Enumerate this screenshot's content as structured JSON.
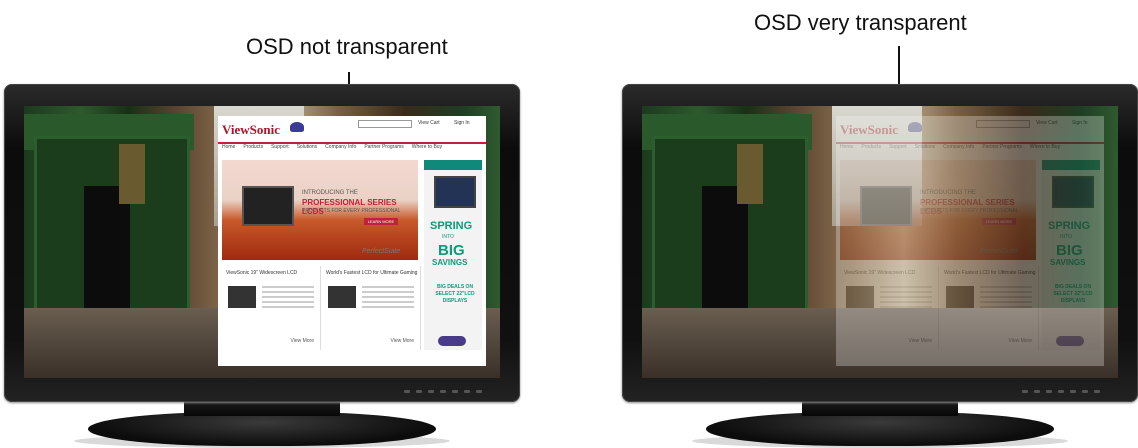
{
  "captions": {
    "left": "OSD not transparent",
    "right": "OSD very transparent"
  },
  "osd": {
    "logo": "ViewSonic",
    "cart": "View Cart",
    "signin": "Sign In",
    "nav": [
      "Home",
      "Products",
      "Support",
      "Solutions",
      "Company Info",
      "Partner Programs",
      "Where to Buy"
    ],
    "hero": {
      "intro": "INTRODUCING THE",
      "headline": "PROFESSIONAL SERIES LCDS",
      "tagline": "PRODUCTS FOR EVERY PROFESSIONAL",
      "button": "LEARN MORE",
      "brand": "PerfectSuite"
    },
    "ad": {
      "spring": "SPRING",
      "into": "INTO",
      "big": "BIG",
      "savings": "SAVINGS",
      "deals": "BIG DEALS ON SELECT 22\"LCD DISPLAYS"
    },
    "row_left": {
      "title": "ViewSonic 19\" Widescreen LCD",
      "more": "View More"
    },
    "row_right": {
      "title": "World's Fastest LCD for Ultimate Gaming",
      "more": "View More"
    }
  },
  "opacity": {
    "left": 1.0,
    "right": 0.28
  }
}
